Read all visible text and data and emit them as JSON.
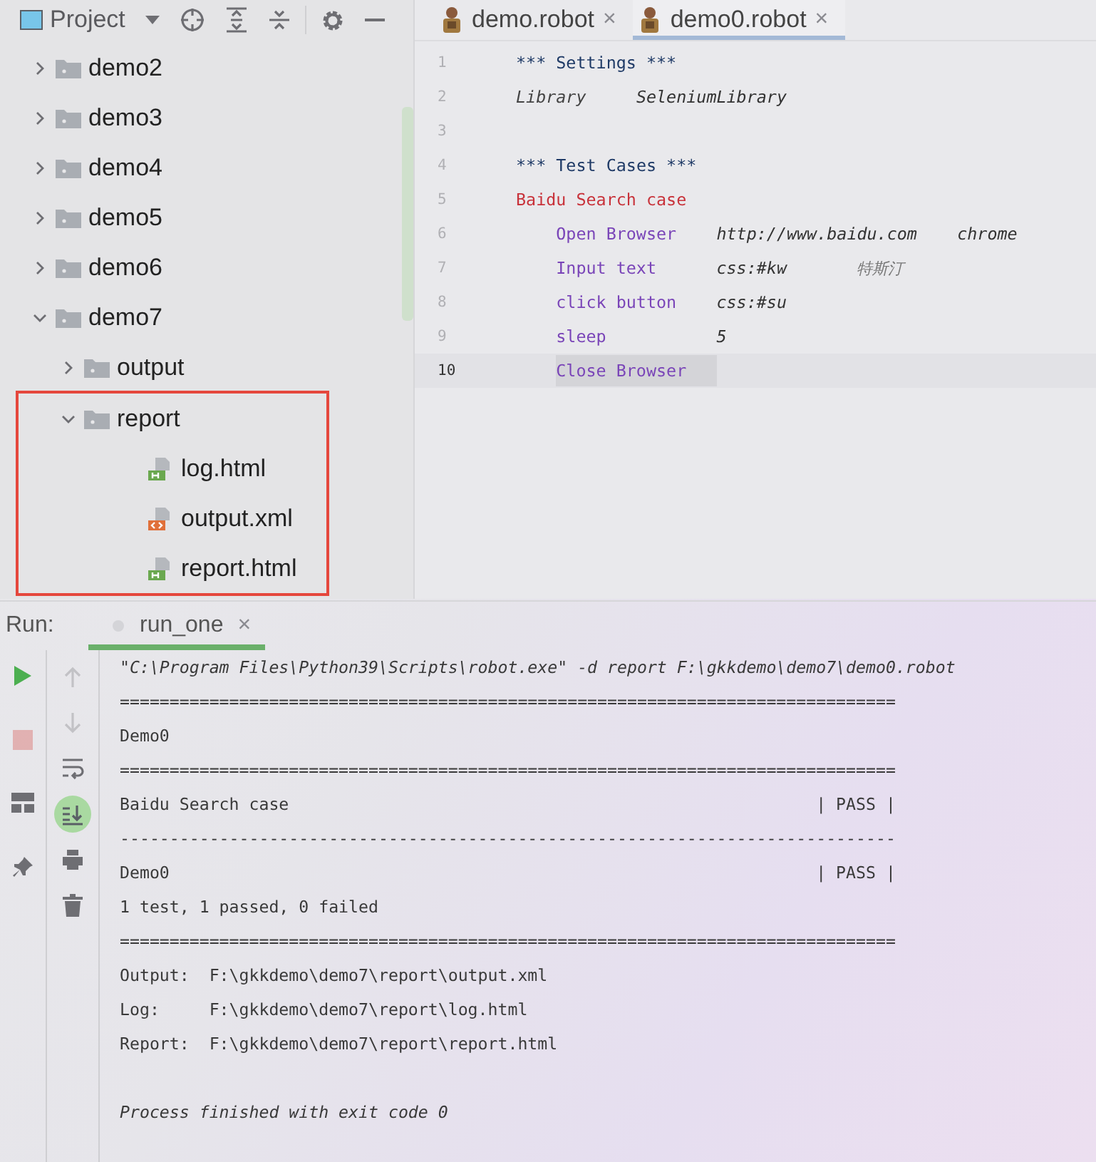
{
  "project_panel": {
    "title": "Project"
  },
  "tree": [
    {
      "name": "demo2",
      "kind": "folder",
      "expanded": false,
      "highlighted": false
    },
    {
      "name": "demo3",
      "kind": "folder",
      "expanded": false,
      "highlighted": false
    },
    {
      "name": "demo4",
      "kind": "folder",
      "expanded": false,
      "highlighted": false
    },
    {
      "name": "demo5",
      "kind": "folder",
      "expanded": false,
      "highlighted": false
    },
    {
      "name": "demo6",
      "kind": "folder",
      "expanded": false,
      "highlighted": false
    },
    {
      "name": "demo7",
      "kind": "folder",
      "expanded": true,
      "highlighted": false,
      "children": [
        {
          "name": "output",
          "kind": "folder",
          "expanded": false,
          "highlighted": false
        },
        {
          "name": "report",
          "kind": "folder",
          "expanded": true,
          "highlighted": true,
          "children": [
            {
              "name": "log.html",
              "kind": "html",
              "highlighted": false
            },
            {
              "name": "output.xml",
              "kind": "xml",
              "highlighted": false
            },
            {
              "name": "report.html",
              "kind": "html",
              "highlighted": false
            }
          ]
        }
      ]
    }
  ],
  "editor_tabs": [
    {
      "label": "demo.robot",
      "close": "×",
      "selected": false
    },
    {
      "label": "demo0.robot",
      "close": "×",
      "selected": true
    }
  ],
  "code_lines": [
    {
      "number": "1",
      "kind": "section",
      "current": false,
      "tokens": [
        {
          "text": "*** Settings ***",
          "kind": "header"
        }
      ]
    },
    {
      "number": "2",
      "kind": "setting",
      "current": false,
      "tokens": [
        {
          "text": "Library",
          "kind": "setting-name"
        },
        {
          "text": "SeleniumLibrary",
          "kind": "arg"
        }
      ]
    },
    {
      "number": "3",
      "kind": "blank",
      "current": false
    },
    {
      "number": "4",
      "kind": "section",
      "current": false,
      "tokens": [
        {
          "text": "*** Test Cases ***",
          "kind": "header"
        }
      ]
    },
    {
      "number": "5",
      "kind": "testcase",
      "current": false,
      "tokens": [
        {
          "text": "Baidu Search case",
          "kind": "testcase"
        }
      ]
    },
    {
      "number": "6",
      "kind": "step",
      "current": false,
      "tokens": [
        {
          "text": "Open Browser",
          "kind": "keyword"
        },
        {
          "text": "http://www.baidu.com",
          "kind": "arg"
        },
        {
          "text": "chrome",
          "kind": "arg"
        }
      ]
    },
    {
      "number": "7",
      "kind": "step",
      "current": false,
      "tokens": [
        {
          "text": "Input text",
          "kind": "keyword"
        },
        {
          "text": "css:#kw",
          "kind": "arg"
        },
        {
          "text": "特斯汀",
          "kind": "text"
        }
      ]
    },
    {
      "number": "8",
      "kind": "step",
      "current": false,
      "tokens": [
        {
          "text": "click button",
          "kind": "keyword"
        },
        {
          "text": "css:#su",
          "kind": "arg"
        }
      ]
    },
    {
      "number": "9",
      "kind": "step",
      "current": false,
      "tokens": [
        {
          "text": "sleep",
          "kind": "keyword"
        },
        {
          "text": "5",
          "kind": "arg"
        }
      ]
    },
    {
      "number": "10",
      "kind": "step",
      "current": true,
      "tokens": [
        {
          "text": "Close Browser",
          "kind": "keyword"
        }
      ]
    }
  ],
  "run_panel": {
    "label": "Run:",
    "tabs": [
      {
        "label": "run_one",
        "close": "×",
        "selected": true
      }
    ]
  },
  "run_toolbar": [
    {
      "kind": "run",
      "disabled": false
    },
    {
      "kind": "stop",
      "disabled": true
    },
    {
      "kind": "layout",
      "disabled": false
    },
    {
      "kind": "pin",
      "disabled": false
    }
  ],
  "console_toolbar": [
    {
      "kind": "up",
      "disabled": true,
      "on": false
    },
    {
      "kind": "down",
      "disabled": true,
      "on": false
    },
    {
      "kind": "wrap",
      "disabled": false,
      "on": false
    },
    {
      "kind": "scroll-end",
      "disabled": false,
      "on": true
    },
    {
      "kind": "print",
      "disabled": false,
      "on": false
    },
    {
      "kind": "trash",
      "disabled": false,
      "on": false
    }
  ],
  "console_lines": [
    {
      "kind": "command",
      "text": "\"C:\\Program Files\\Python39\\Scripts\\robot.exe\" -d report F:\\gkkdemo\\demo7\\demo0.robot"
    },
    {
      "kind": "rule",
      "text": "=============================================================================="
    },
    {
      "kind": "plain",
      "text": "Demo0"
    },
    {
      "kind": "rule",
      "text": "=============================================================================="
    },
    {
      "kind": "result",
      "name": "Baidu Search case",
      "status": "| PASS |"
    },
    {
      "kind": "rule",
      "text": "------------------------------------------------------------------------------"
    },
    {
      "kind": "result",
      "name": "Demo0",
      "status": "| PASS |"
    },
    {
      "kind": "plain",
      "text": "1 test, 1 passed, 0 failed"
    },
    {
      "kind": "rule",
      "text": "=============================================================================="
    },
    {
      "kind": "plain",
      "text": "Output:  F:\\gkkdemo\\demo7\\report\\output.xml"
    },
    {
      "kind": "plain",
      "text": "Log:     F:\\gkkdemo\\demo7\\report\\log.html"
    },
    {
      "kind": "plain",
      "text": "Report:  F:\\gkkdemo\\demo7\\report\\report.html"
    },
    {
      "kind": "blank"
    },
    {
      "kind": "finish",
      "text": "Process finished with exit code 0"
    }
  ]
}
